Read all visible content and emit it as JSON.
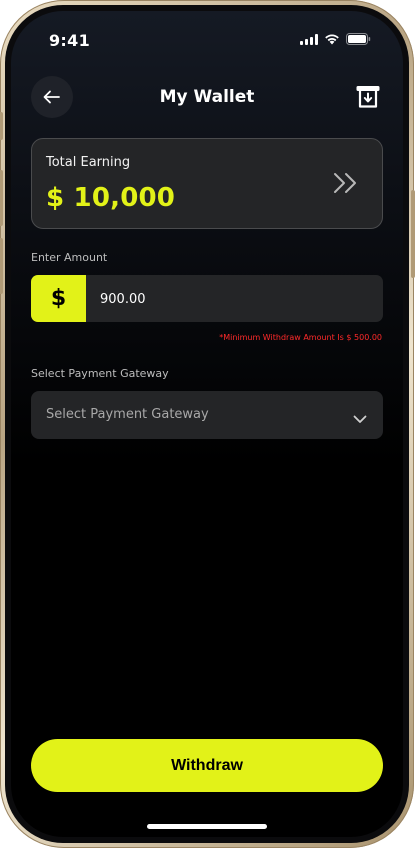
{
  "status_bar": {
    "time": "9:41"
  },
  "header": {
    "title": "My Wallet",
    "back_icon": "arrow-left-icon",
    "action_icon": "download-receipt-icon"
  },
  "earning_card": {
    "label": "Total Earning",
    "amount": "$ 10,000",
    "arrow_icon": "double-chevron-right-icon"
  },
  "amount_field": {
    "label": "Enter Amount",
    "prefix": "$",
    "value": "900.00",
    "note": "*Minimum Withdraw Amount Is $ 500.00"
  },
  "gateway": {
    "label": "Select Payment Gateway",
    "placeholder": "Select Payment Gateway",
    "chevron_icon": "chevron-down-icon"
  },
  "withdraw_button": {
    "label": "Withdraw"
  },
  "colors": {
    "accent": "#E2F218",
    "card": "#242527",
    "error": "#FF2A2A",
    "background": "#000000"
  }
}
